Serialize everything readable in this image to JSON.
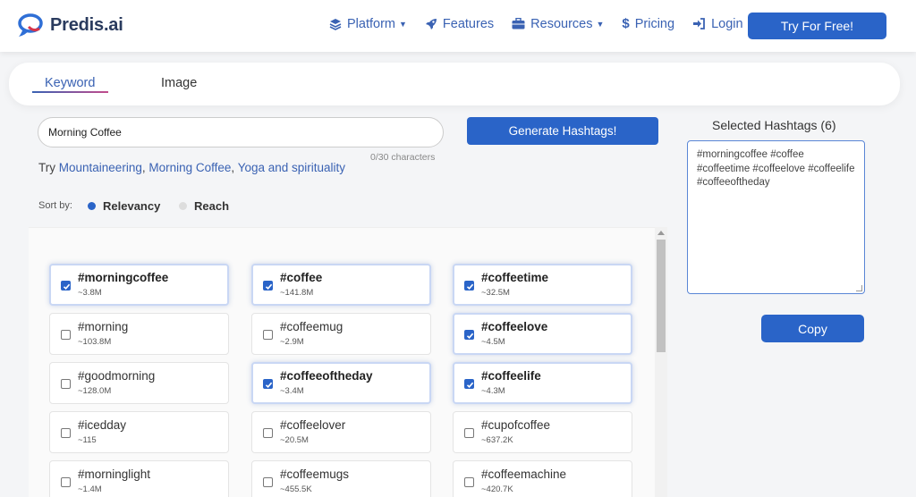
{
  "brand": {
    "name": "Predis.ai",
    "colors": {
      "primary": "#2a64c8",
      "link": "#3a62b3",
      "logo_blue": "#2f6fd6",
      "logo_red": "#d7354a"
    }
  },
  "nav": {
    "items": [
      {
        "label": "Platform",
        "icon": "layers-icon",
        "dropdown": true
      },
      {
        "label": "Features",
        "icon": "rocket-icon",
        "dropdown": false
      },
      {
        "label": "Resources",
        "icon": "briefcase-icon",
        "dropdown": true
      },
      {
        "label": "Pricing",
        "icon": "dollar-icon",
        "dropdown": false
      },
      {
        "label": "Login",
        "icon": "login-icon",
        "dropdown": false
      }
    ],
    "cta": "Try For Free!"
  },
  "tabs": [
    {
      "label": "Keyword",
      "active": true
    },
    {
      "label": "Image",
      "active": false
    }
  ],
  "search": {
    "value": "Morning Coffee",
    "char_count": "0/30 characters",
    "try_prefix": "Try",
    "suggestions": [
      "Mountaineering",
      "Morning Coffee",
      "Yoga and spirituality"
    ],
    "generate_label": "Generate Hashtags!"
  },
  "sort": {
    "label": "Sort by:",
    "options": [
      {
        "label": "Relevancy",
        "selected": true
      },
      {
        "label": "Reach",
        "selected": false
      }
    ]
  },
  "hashtags": [
    {
      "tag": "#morningcoffee",
      "reach": "~3.8M",
      "checked": true
    },
    {
      "tag": "#coffee",
      "reach": "~141.8M",
      "checked": true
    },
    {
      "tag": "#coffeetime",
      "reach": "~32.5M",
      "checked": true
    },
    {
      "tag": "#morning",
      "reach": "~103.8M",
      "checked": false
    },
    {
      "tag": "#coffeemug",
      "reach": "~2.9M",
      "checked": false
    },
    {
      "tag": "#coffeelove",
      "reach": "~4.5M",
      "checked": true
    },
    {
      "tag": "#goodmorning",
      "reach": "~128.0M",
      "checked": false
    },
    {
      "tag": "#coffeeoftheday",
      "reach": "~3.4M",
      "checked": true
    },
    {
      "tag": "#coffeelife",
      "reach": "~4.3M",
      "checked": true
    },
    {
      "tag": "#icedday",
      "reach": "~115",
      "checked": false
    },
    {
      "tag": "#coffeelover",
      "reach": "~20.5M",
      "checked": false
    },
    {
      "tag": "#cupofcoffee",
      "reach": "~637.2K",
      "checked": false
    },
    {
      "tag": "#morninglight",
      "reach": "~1.4M",
      "checked": false
    },
    {
      "tag": "#coffeemugs",
      "reach": "~455.5K",
      "checked": false
    },
    {
      "tag": "#coffeemachine",
      "reach": "~420.7K",
      "checked": false
    }
  ],
  "selected": {
    "title": "Selected Hashtags (6)",
    "text": "#morningcoffee #coffee #coffeetime #coffeelove #coffeelife #coffeeoftheday",
    "copy_label": "Copy"
  }
}
